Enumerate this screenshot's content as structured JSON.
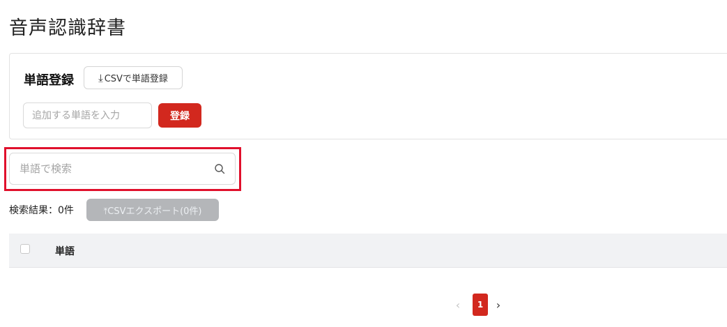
{
  "page": {
    "title": "音声認識辞書"
  },
  "register": {
    "title": "単語登録",
    "csv_import_icon": "download-icon",
    "csv_import_glyph": "⤓",
    "csv_import_label": "CSVで単語登録",
    "input_placeholder": "追加する単語を入力",
    "input_value": "",
    "submit_label": "登録",
    "accent_color": "#d2281e"
  },
  "search": {
    "placeholder": "単語で検索",
    "value": "",
    "icon": "search-icon",
    "highlight_color": "#e0102c"
  },
  "results": {
    "count_label": "検索結果：0件",
    "export_icon": "upload-icon",
    "export_label": "⤒CSVエクスポート(0件)",
    "export_disabled": true
  },
  "table": {
    "columns": [
      "単語"
    ],
    "rows": []
  },
  "pagination": {
    "prev": "‹",
    "current": "1",
    "next": "›"
  }
}
